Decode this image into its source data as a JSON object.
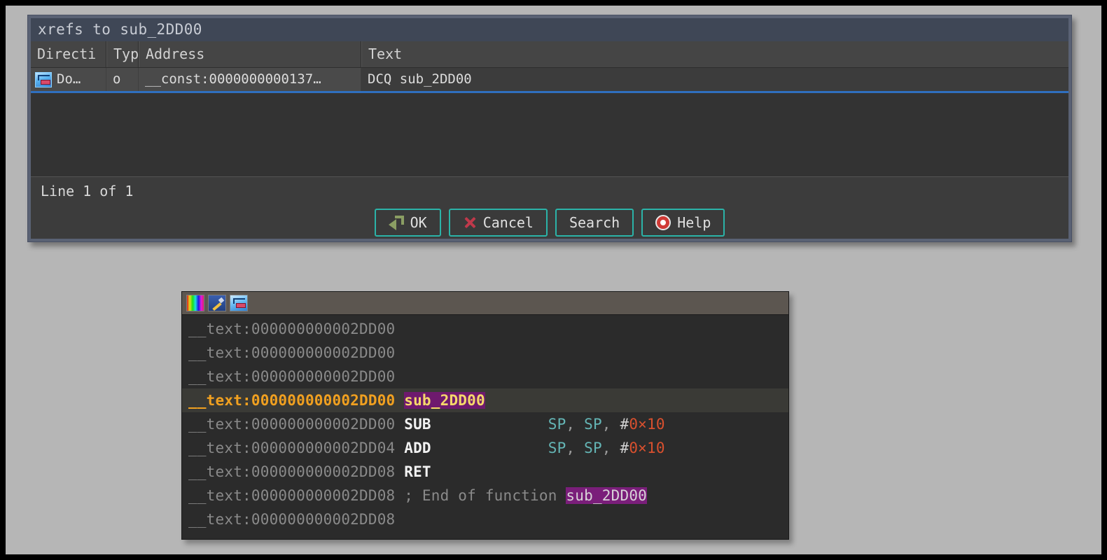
{
  "dialog": {
    "title": "xrefs to sub_2DD00",
    "columns": [
      "Directi",
      "Typ",
      "Address",
      "Text"
    ],
    "rows": [
      {
        "icon": "xrefs-icon",
        "direction": "Do…",
        "type": "o",
        "address": "__const:0000000000137…",
        "text": "DCQ sub_2DD00"
      }
    ],
    "status": "Line 1 of 1",
    "buttons": [
      {
        "label": "OK",
        "icon": "enter-arrow-icon"
      },
      {
        "label": "Cancel",
        "icon": "red-x-icon"
      },
      {
        "label": "Search",
        "icon": ""
      },
      {
        "label": "Help",
        "icon": "life-ring-icon"
      }
    ]
  },
  "disassembly": {
    "toolbar_icons": [
      "color-palette-icon",
      "pencil-edit-icon",
      "xrefs-icon"
    ],
    "lines": [
      {
        "addr": "__text:000000000002DD00",
        "kind": "blank",
        "highlight": false
      },
      {
        "addr": "__text:000000000002DD00",
        "kind": "blank",
        "highlight": false
      },
      {
        "addr": "__text:000000000002DD00",
        "kind": "blank",
        "highlight": false
      },
      {
        "addr": "__text:000000000002DD00",
        "kind": "label",
        "highlight": true,
        "label": "sub_2DD00"
      },
      {
        "addr": "__text:000000000002DD00",
        "kind": "insn",
        "highlight": false,
        "mnemonic": "SUB",
        "reg1": "SP",
        "reg2": "SP",
        "imm_prefix": "#",
        "imm": "0×10"
      },
      {
        "addr": "__text:000000000002DD04",
        "kind": "insn",
        "highlight": false,
        "mnemonic": "ADD",
        "reg1": "SP",
        "reg2": "SP",
        "imm_prefix": "#",
        "imm": "0×10"
      },
      {
        "addr": "__text:000000000002DD08",
        "kind": "ret",
        "highlight": false,
        "mnemonic": "RET"
      },
      {
        "addr": "__text:000000000002DD08",
        "kind": "comment",
        "highlight": false,
        "comment": "; End of function ",
        "ref": "sub_2DD00"
      },
      {
        "addr": "__text:000000000002DD08",
        "kind": "blank",
        "highlight": false
      }
    ]
  },
  "colors": {
    "dialog_titlebar": "#3f4756",
    "dialog_frame": "#5a6274",
    "panel_background": "#2b2b2b",
    "toolbar_background": "#5c5650",
    "button_accent": "#2bb3a8",
    "address_gray": "#8a8a8a",
    "address_highlight": "#f0a020",
    "name_highlight_bg": "#6e1a6e",
    "register_teal": "#64b5b5",
    "immediate_red": "#d9502e",
    "row_underline": "#2f6fbf"
  }
}
